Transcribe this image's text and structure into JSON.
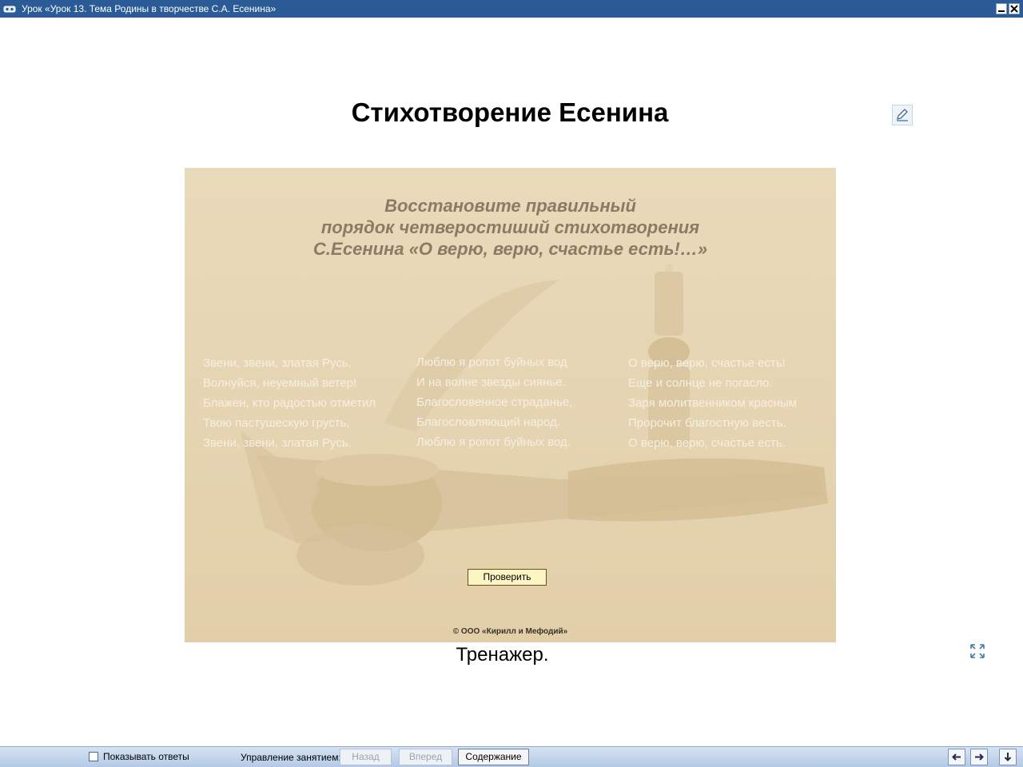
{
  "window": {
    "title": "Урок «Урок 13. Тема Родины в творчестве С.А. Есенина»",
    "icons": {
      "app": "app-logo-icon",
      "minimize": "minimize-icon",
      "close": "close-icon"
    }
  },
  "page": {
    "title": "Стихотворение Есенина",
    "edit_icon": "pencil-icon",
    "caption": "Тренажер.",
    "expand_icon": "expand-icon"
  },
  "trainer": {
    "instruction_lines": [
      "Восстановите правильный",
      "порядок четверостиший стихотворения",
      "С.Есенина «О верю, верю, счастье есть!…»"
    ],
    "stanzas": [
      {
        "lines": [
          "Звени, звени, златая Русь,",
          "Волнуйся, неуемный ветер!",
          "Блажен, кто радостью отметил",
          "Твою пастушескую грусть,",
          "Звени, звени, златая Русь."
        ]
      },
      {
        "lines": [
          "Люблю я ропот буйных вод",
          "И на волне звезды сиянье.",
          "Благословенное страданье,",
          "Благословляющий народ.",
          "Люблю я ропот буйных вод."
        ]
      },
      {
        "lines": [
          "О верю, верю, счастье есть!",
          "Еще и солнце не погасло.",
          "Заря молитвенником красным",
          "Пророчит благостную весть.",
          "О верю, верю, счастье есть."
        ]
      }
    ],
    "check_button": "Проверить",
    "copyright": "© ООО «Кирилл и Мефодий»"
  },
  "toolbar": {
    "show_answers_label": "Показывать ответы",
    "show_answers_checked": false,
    "control_label": "Управление занятием:",
    "back_label": "Назад",
    "forward_label": "Вперед",
    "contents_label": "Содержание",
    "icons": {
      "prev": "arrow-left-icon",
      "next": "arrow-right-icon",
      "down": "arrow-down-icon"
    }
  },
  "colors": {
    "titlebar": "#2b5b96",
    "panel_background": "#e6d5b2",
    "instruction_text": "#8c7a64",
    "poem_text": "#f6efe2",
    "check_button_fill": "#fdf6c4",
    "toolbar": "#c4d6ee"
  }
}
